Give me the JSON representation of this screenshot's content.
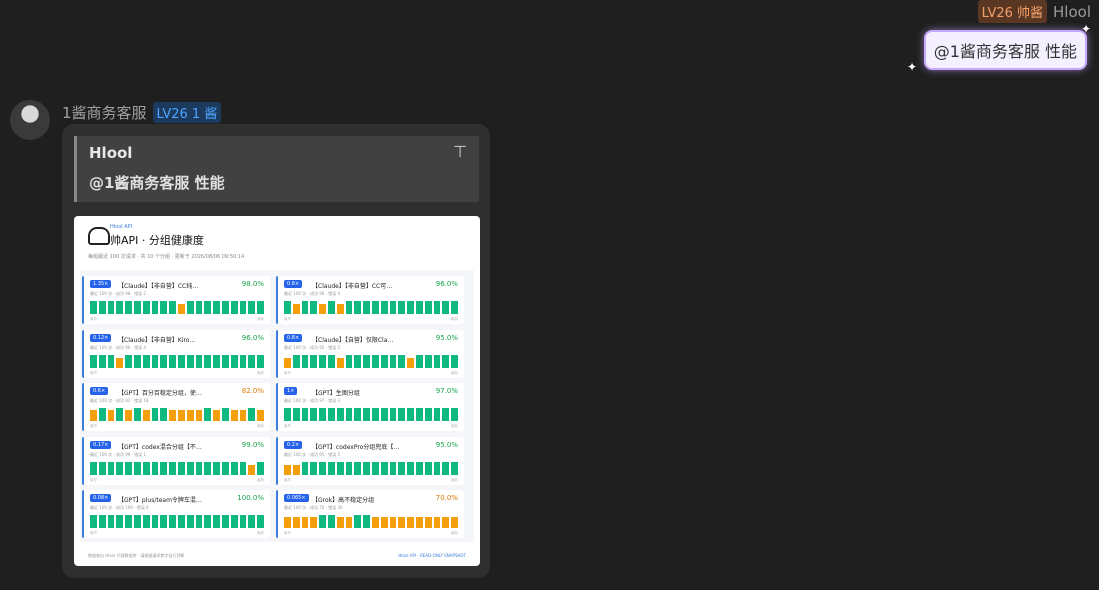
{
  "me": {
    "level": "LV26 帅酱",
    "name": "Hlool",
    "message": "@1酱商务客服 性能"
  },
  "other": {
    "name": "1酱商务客服",
    "level": "LV26 1 酱"
  },
  "quote": {
    "name": "Hlool",
    "text": "@1酱商务客服 性能",
    "pin_icon": "pin-icon"
  },
  "card": {
    "brand": "Hlool API",
    "title": "帅API · 分组健康度",
    "subinfo": "每组最近 100 次请求 · 共 10 个分组 · 更新于 2026/08/06 09:50:14",
    "footer_left": "数据来自 Hlool 代理数据库 · 请根据请求数字自行判断",
    "footer_right": "Hlool API · READ-ONLY SNAPSHOT",
    "edge_left": "最早",
    "edge_right": "最新",
    "colors": {
      "good": "#10b981",
      "warn": "#f59e0b",
      "pct_good": "#16a34a",
      "pct_warn": "#d97706"
    },
    "panels": [
      {
        "mult": "1.35×",
        "name": "【Claude】【非自营】CC纯…",
        "pct": "98.0%",
        "level": "good",
        "meta": "最近 100 次 · 成功 98 · 错误 2",
        "bars": [
          1,
          1,
          1,
          1,
          1,
          1,
          1,
          1,
          1,
          1,
          0,
          1,
          1,
          1,
          1,
          1,
          1,
          1,
          1,
          1
        ]
      },
      {
        "mult": "0.8×",
        "name": "【Claude】【非自营】CC可…",
        "pct": "96.0%",
        "level": "good",
        "meta": "最近 100 次 · 成功 96 · 错误 4",
        "bars": [
          1,
          0,
          1,
          1,
          0,
          1,
          0,
          1,
          1,
          1,
          1,
          1,
          1,
          1,
          1,
          1,
          1,
          1,
          1,
          1
        ]
      },
      {
        "mult": "0.12×",
        "name": "【Claude】【非自营】Kiro…",
        "pct": "96.0%",
        "level": "good",
        "meta": "最近 100 次 · 成功 96 · 错误 4",
        "bars": [
          1,
          1,
          1,
          0,
          1,
          1,
          1,
          1,
          1,
          1,
          1,
          1,
          1,
          1,
          1,
          1,
          1,
          1,
          1,
          1
        ]
      },
      {
        "mult": "0.8×",
        "name": "【Claude】【自营】仅限Cla…",
        "pct": "95.0%",
        "level": "good",
        "meta": "最近 100 次 · 成功 95 · 错误 5",
        "bars": [
          0,
          1,
          1,
          1,
          1,
          1,
          0,
          1,
          1,
          1,
          1,
          1,
          1,
          1,
          0,
          1,
          1,
          1,
          1,
          1
        ]
      },
      {
        "mult": "0.6×",
        "name": "【GPT】百分百稳定分组，使…",
        "pct": "82.0%",
        "level": "warn",
        "meta": "最近 100 次 · 成功 82 · 错误 18",
        "bars": [
          0,
          1,
          0,
          1,
          0,
          1,
          0,
          1,
          1,
          0,
          0,
          0,
          0,
          1,
          0,
          1,
          0,
          0,
          1,
          0
        ]
      },
      {
        "mult": "1×",
        "name": "【GPT】生图分组",
        "pct": "97.0%",
        "level": "good",
        "meta": "最近 100 次 · 成功 97 · 错误 3",
        "bars": [
          1,
          1,
          1,
          1,
          1,
          1,
          1,
          1,
          1,
          1,
          1,
          1,
          1,
          1,
          1,
          1,
          1,
          1,
          1,
          1
        ]
      },
      {
        "mult": "0.17×",
        "name": "【GPT】codex混合分组【不…",
        "pct": "99.0%",
        "level": "good",
        "meta": "最近 100 次 · 成功 99 · 错误 1",
        "bars": [
          1,
          1,
          1,
          1,
          1,
          1,
          1,
          1,
          1,
          1,
          1,
          1,
          1,
          1,
          1,
          1,
          1,
          1,
          0,
          1
        ]
      },
      {
        "mult": "0.2×",
        "name": "【GPT】codexPro分组兜底【…",
        "pct": "95.0%",
        "level": "good",
        "meta": "最近 100 次 · 成功 95 · 错误 5",
        "bars": [
          0,
          0,
          1,
          1,
          1,
          1,
          1,
          1,
          1,
          1,
          1,
          1,
          1,
          1,
          1,
          1,
          1,
          1,
          1,
          1
        ]
      },
      {
        "mult": "0.08×",
        "name": "【GPT】plus/team令牌车混…",
        "pct": "100.0%",
        "level": "good",
        "meta": "最近 100 次 · 成功 100 · 错误 0",
        "bars": [
          1,
          1,
          1,
          1,
          1,
          1,
          1,
          1,
          1,
          1,
          1,
          1,
          1,
          1,
          1,
          1,
          1,
          1,
          1,
          1
        ]
      },
      {
        "mult": "0.065×",
        "name": "【Grok】高不稳定分组",
        "pct": "70.0%",
        "level": "warn",
        "meta": "最近 100 次 · 成功 70 · 错误 30",
        "bars": [
          0,
          0,
          0,
          0,
          1,
          1,
          0,
          0,
          1,
          1,
          0,
          0,
          0,
          0,
          0,
          0,
          0,
          0,
          0,
          0
        ]
      }
    ]
  }
}
